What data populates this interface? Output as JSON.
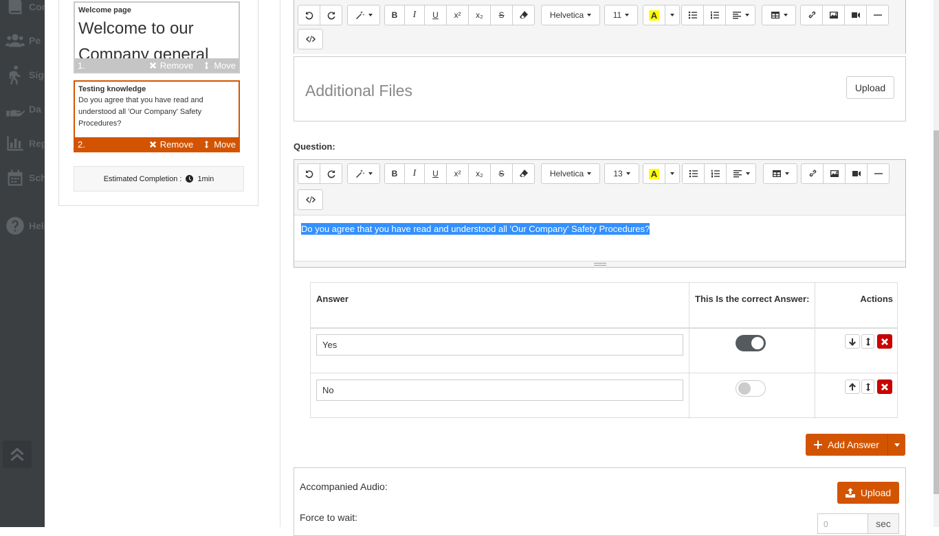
{
  "sidebar": {
    "items": [
      {
        "label": "Com",
        "icon": "book-icon"
      },
      {
        "label": "Pe",
        "icon": "users-icon"
      },
      {
        "label": "Sign",
        "icon": "walking-person-icon"
      },
      {
        "label": "Da",
        "icon": "hand-icon"
      },
      {
        "label": "Rep",
        "icon": "bar-chart-icon"
      },
      {
        "label": "Sche",
        "icon": "calendar-icon"
      },
      {
        "label": "Help",
        "icon": "question-circle-icon"
      }
    ],
    "collapse_icon": "double-chevron-up-icon"
  },
  "overview": {
    "cards": [
      {
        "title": "Welcome page",
        "preview": "Welcome to our Company general",
        "number": "1.",
        "remove": "Remove",
        "move": "Move"
      },
      {
        "title": "Testing knowledge",
        "preview": "Do you agree that you have read and understood all 'Our Company' Safety Procedures?",
        "number": "2.",
        "remove": "Remove",
        "move": "Move"
      }
    ],
    "estimated_label": "Estimated Completion :",
    "estimated_value": "1min"
  },
  "editor_top": {
    "font": "Helvetica",
    "size": "11"
  },
  "additional_files": {
    "title": "Additional Files",
    "upload": "Upload"
  },
  "question": {
    "label": "Question:",
    "font": "Helvetica",
    "size": "13",
    "text": "Do you agree that you have read and understood all 'Our Company' Safety Procedures?"
  },
  "answers_table": {
    "headers": {
      "answer": "Answer",
      "correct": "This Is the correct Answer:",
      "actions": "Actions"
    },
    "rows": [
      {
        "value": "Yes",
        "correct": true
      },
      {
        "value": "No",
        "correct": false
      }
    ]
  },
  "add_answer": "Add Answer",
  "audio": {
    "label": "Accompanied Audio:",
    "upload": "Upload",
    "wait_label": "Force to wait:",
    "wait_placeholder": "0",
    "wait_unit": "sec"
  },
  "colors": {
    "accent": "#d35400",
    "danger": "#cc0000",
    "sidebar": "#3b3f42"
  }
}
